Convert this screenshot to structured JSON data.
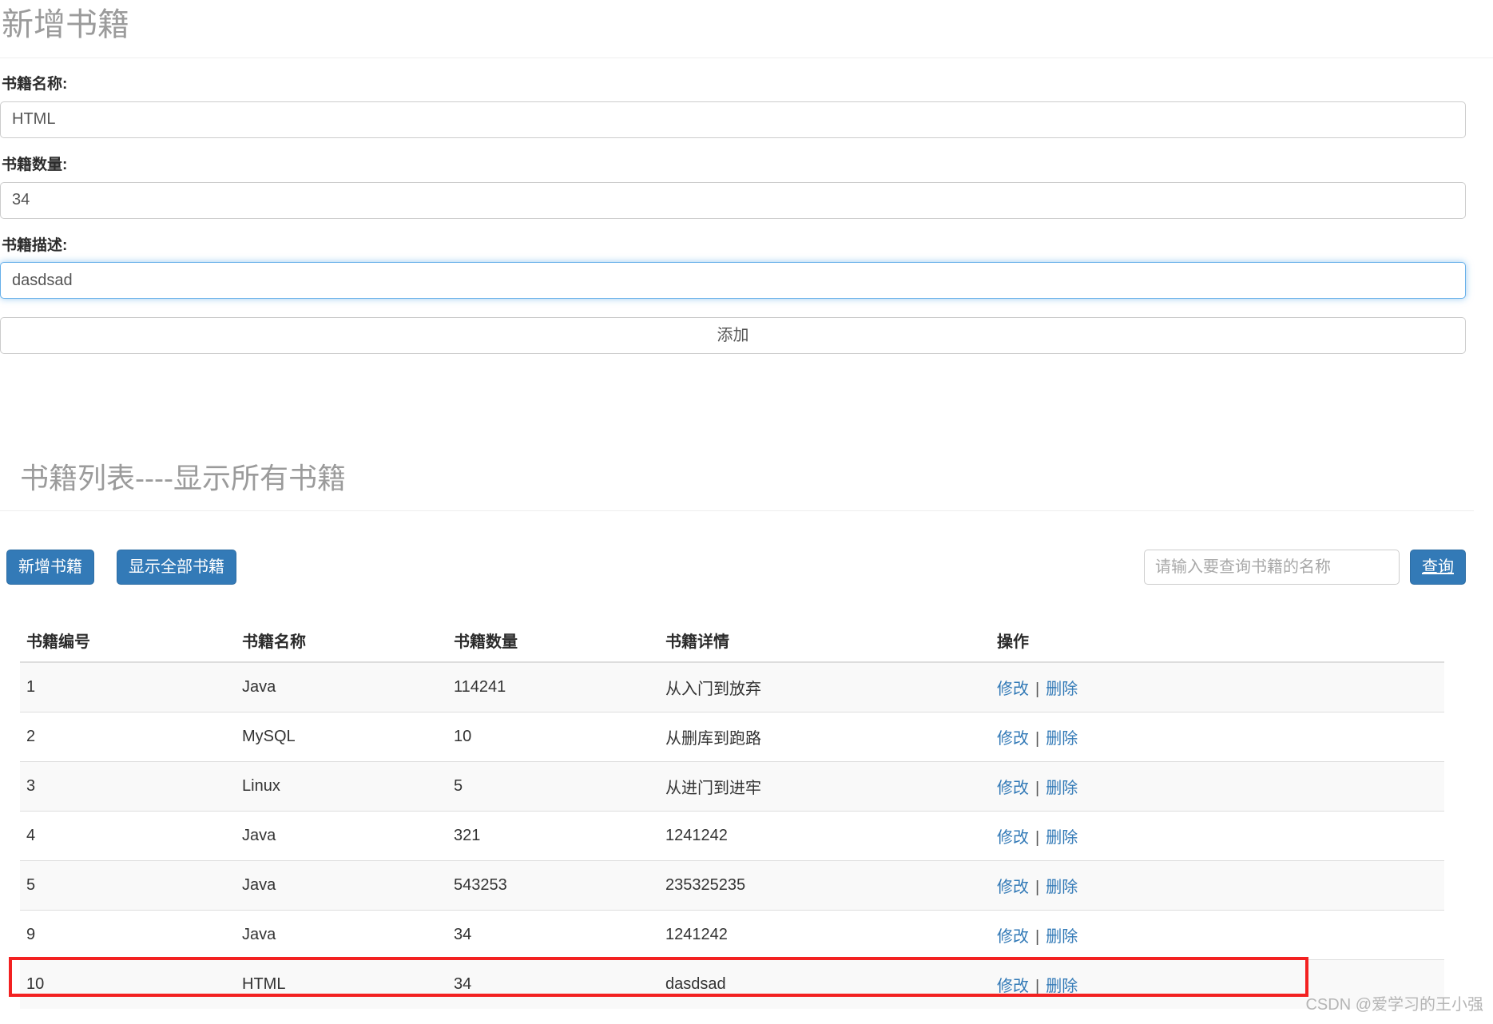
{
  "add_form": {
    "title": "新增书籍",
    "fields": [
      {
        "label": "书籍名称:",
        "value": "HTML",
        "focused": false
      },
      {
        "label": "书籍数量:",
        "value": "34",
        "focused": false
      },
      {
        "label": "书籍描述:",
        "value": "dasdsad",
        "focused": true
      }
    ],
    "submit_label": "添加"
  },
  "list": {
    "title": "书籍列表----显示所有书籍",
    "toolbar": {
      "add_book_label": "新增书籍",
      "show_all_label": "显示全部书籍",
      "search_placeholder": "请输入要查询书籍的名称",
      "search_value": "",
      "search_button_label": "查询"
    },
    "columns": [
      "书籍编号",
      "书籍名称",
      "书籍数量",
      "书籍详情",
      "操作"
    ],
    "ops": {
      "edit_label": "修改",
      "separator": "|",
      "delete_label": "删除"
    },
    "rows": [
      {
        "id": "1",
        "name": "Java",
        "qty": "114241",
        "detail": "从入门到放弃",
        "highlighted": false
      },
      {
        "id": "2",
        "name": "MySQL",
        "qty": "10",
        "detail": "从删库到跑路",
        "highlighted": false
      },
      {
        "id": "3",
        "name": "Linux",
        "qty": "5",
        "detail": "从进门到进牢",
        "highlighted": false
      },
      {
        "id": "4",
        "name": "Java",
        "qty": "321",
        "detail": "1241242",
        "highlighted": false
      },
      {
        "id": "5",
        "name": "Java",
        "qty": "543253",
        "detail": "235325235",
        "highlighted": false
      },
      {
        "id": "9",
        "name": "Java",
        "qty": "34",
        "detail": "1241242",
        "highlighted": false
      },
      {
        "id": "10",
        "name": "HTML",
        "qty": "34",
        "detail": "dasdsad",
        "highlighted": true
      }
    ]
  },
  "watermark": "CSDN @爱学习的王小强",
  "colors": {
    "primary": "#337ab7",
    "highlight": "#f32121",
    "muted_title": "#9b9b9b",
    "stripe": "#f9f9f9"
  }
}
